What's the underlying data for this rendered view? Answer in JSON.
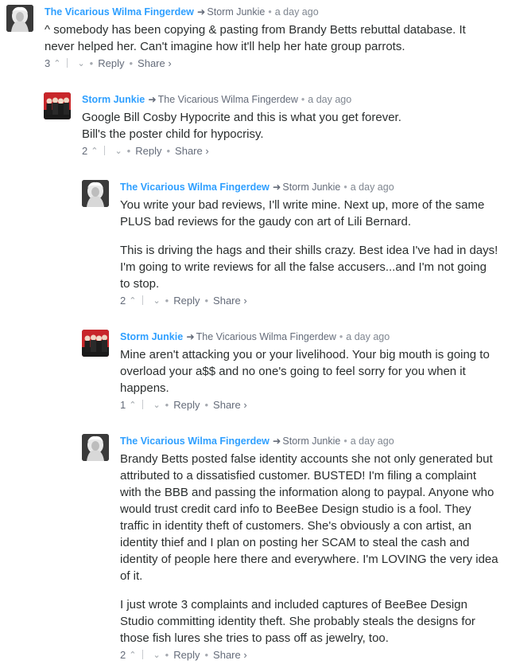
{
  "comments": [
    {
      "author": "The Vicarious Wilma Fingerdew",
      "reply_to": "Storm Junkie",
      "time": "a day ago",
      "avatar": "portrait",
      "paragraphs": [
        "^ somebody has been copying & pasting from Brandy Betts rebuttal database. It never helped her. Can't imagine how it'll help her hate group parrots."
      ],
      "votes": "3",
      "reply_label": "Reply",
      "share_label": "Share ›"
    },
    {
      "author": "Storm Junkie",
      "reply_to": "The Vicarious Wilma Fingerdew",
      "time": "a day ago",
      "avatar": "band",
      "paragraphs": [
        "Google Bill Cosby Hypocrite and this is what you get forever.\nBill's the poster child for hypocrisy."
      ],
      "votes": "2",
      "reply_label": "Reply",
      "share_label": "Share ›"
    },
    {
      "author": "The Vicarious Wilma Fingerdew",
      "reply_to": "Storm Junkie",
      "time": "a day ago",
      "avatar": "portrait",
      "paragraphs": [
        "You write your bad reviews, I'll write mine. Next up, more of the same PLUS bad reviews for the gaudy con art of Lili Bernard.",
        "This is driving the hags and their shills crazy. Best idea I've had in days! I'm going to write reviews for all the false accusers...and I'm not going to stop."
      ],
      "votes": "2",
      "reply_label": "Reply",
      "share_label": "Share ›"
    },
    {
      "author": "Storm Junkie",
      "reply_to": "The Vicarious Wilma Fingerdew",
      "time": "a day ago",
      "avatar": "band",
      "paragraphs": [
        "Mine aren't attacking you or your livelihood. Your big mouth is going to overload your a$$ and no one's going to feel sorry for you when it happens."
      ],
      "votes": "1",
      "reply_label": "Reply",
      "share_label": "Share ›"
    },
    {
      "author": "The Vicarious Wilma Fingerdew",
      "reply_to": "Storm Junkie",
      "time": "a day ago",
      "avatar": "portrait",
      "paragraphs": [
        "Brandy Betts posted false identity accounts she not only generated but attributed to a dissatisfied customer. BUSTED! I'm filing a complaint with the BBB and passing the information along to paypal. Anyone who would trust credit card info to BeeBee Design studio is a fool. They traffic in identity theft of customers. She's obviously a con artist, an identity thief and I plan on posting her SCAM to steal the cash and identity of people here there and everywhere. I'm LOVING the very idea of it.",
        "I just wrote 3 complaints and included captures of BeeBee Design Studio committing identity theft. She probably steals the designs for those fish lures she tries to pass off as jewelry, too."
      ],
      "votes": "2",
      "reply_label": "Reply",
      "share_label": "Share ›"
    }
  ],
  "colors": {
    "author": "#2e9fff",
    "meta": "#656c7a",
    "text": "#2a2e2e"
  }
}
